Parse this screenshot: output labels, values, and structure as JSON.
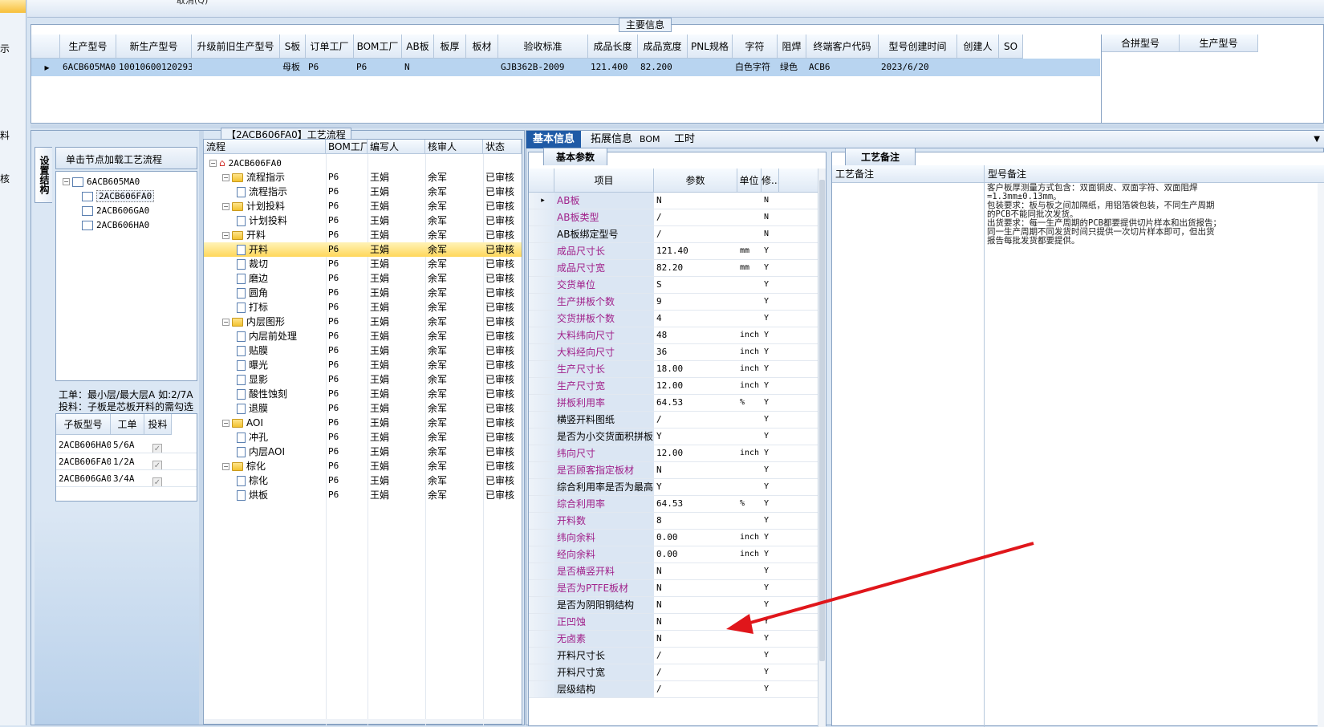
{
  "left_strip": {
    "items": [
      "示",
      "料",
      "核"
    ]
  },
  "top_bar": {
    "text": "取消(Q)"
  },
  "main_info": {
    "title": "主要信息",
    "columns": [
      "生产型号",
      "新生产型号",
      "升级前旧生产型号",
      "S板",
      "订单工厂",
      "BOM工厂",
      "AB板",
      "板厚",
      "板材",
      "验收标准",
      "成品长度",
      "成品宽度",
      "PNL规格",
      "字符",
      "阻焊",
      "终端客户代码",
      "型号创建时间",
      "创建人",
      "SO"
    ],
    "row": [
      "6ACB605MA0",
      "10010600120293",
      "",
      "母板",
      "P6",
      "P6",
      "N",
      "",
      "",
      "GJB362B-2009",
      "121.400",
      "82.200",
      "",
      "白色字符",
      "绿色",
      "ACB6",
      "2023/6/20",
      "",
      ""
    ],
    "right_columns": [
      "合拼型号",
      "生产型号"
    ]
  },
  "process_panel": {
    "title": "【2ACB606FA0】工艺流程",
    "side_tab": "设置结构",
    "hint": "单击节点加载工艺流程",
    "tree": [
      {
        "label": "6ACB605MA0",
        "level": 0,
        "expander": "⊟"
      },
      {
        "label": "2ACB606FA0",
        "level": 1,
        "selected": true
      },
      {
        "label": "2ACB606GA0",
        "level": 1
      },
      {
        "label": "2ACB606HA0",
        "level": 1
      }
    ],
    "note_line1": "工单：最小层/最大层A 如:2/7A",
    "note_line2": "投料：子板是芯板开料的需勾选",
    "sub_columns": [
      "子板型号",
      "工单",
      "投料"
    ],
    "sub_rows": [
      {
        "model": "2ACB606HA0",
        "order": "5/6A",
        "check": "✓"
      },
      {
        "model": "2ACB606FA0",
        "order": "1/2A",
        "check": "✓"
      },
      {
        "model": "2ACB606GA0",
        "order": "3/4A",
        "check": "✓"
      }
    ]
  },
  "flow": {
    "columns": [
      "流程",
      "BOM工厂",
      "编写人",
      "核审人",
      "状态"
    ],
    "root": "2ACB606FA0",
    "rows": [
      {
        "name": "流程指示",
        "type": "folder",
        "factory": "P6",
        "author": "王娟",
        "reviewer": "余军",
        "status": "已审核"
      },
      {
        "name": "流程指示",
        "type": "doc",
        "factory": "P6",
        "author": "王娟",
        "reviewer": "余军",
        "status": "已审核"
      },
      {
        "name": "计划投料",
        "type": "folder",
        "factory": "P6",
        "author": "王娟",
        "reviewer": "余军",
        "status": "已审核"
      },
      {
        "name": "计划投料",
        "type": "doc",
        "factory": "P6",
        "author": "王娟",
        "reviewer": "余军",
        "status": "已审核"
      },
      {
        "name": "开料",
        "type": "folder",
        "factory": "P6",
        "author": "王娟",
        "reviewer": "余军",
        "status": "已审核"
      },
      {
        "name": "开料",
        "type": "doc",
        "factory": "P6",
        "author": "王娟",
        "reviewer": "余军",
        "status": "已审核",
        "selected": true
      },
      {
        "name": "裁切",
        "type": "doc",
        "factory": "P6",
        "author": "王娟",
        "reviewer": "余军",
        "status": "已审核"
      },
      {
        "name": "磨边",
        "type": "doc",
        "factory": "P6",
        "author": "王娟",
        "reviewer": "余军",
        "status": "已审核"
      },
      {
        "name": "圆角",
        "type": "doc",
        "factory": "P6",
        "author": "王娟",
        "reviewer": "余军",
        "status": "已审核"
      },
      {
        "name": "打标",
        "type": "doc",
        "factory": "P6",
        "author": "王娟",
        "reviewer": "余军",
        "status": "已审核"
      },
      {
        "name": "内层图形",
        "type": "folder",
        "factory": "P6",
        "author": "王娟",
        "reviewer": "余军",
        "status": "已审核"
      },
      {
        "name": "内层前处理",
        "type": "doc",
        "factory": "P6",
        "author": "王娟",
        "reviewer": "余军",
        "status": "已审核"
      },
      {
        "name": "贴膜",
        "type": "doc",
        "factory": "P6",
        "author": "王娟",
        "reviewer": "余军",
        "status": "已审核"
      },
      {
        "name": "曝光",
        "type": "doc",
        "factory": "P6",
        "author": "王娟",
        "reviewer": "余军",
        "status": "已审核"
      },
      {
        "name": "显影",
        "type": "doc",
        "factory": "P6",
        "author": "王娟",
        "reviewer": "余军",
        "status": "已审核"
      },
      {
        "name": "酸性蚀刻",
        "type": "doc",
        "factory": "P6",
        "author": "王娟",
        "reviewer": "余军",
        "status": "已审核"
      },
      {
        "name": "退膜",
        "type": "doc",
        "factory": "P6",
        "author": "王娟",
        "reviewer": "余军",
        "status": "已审核"
      },
      {
        "name": "AOI",
        "type": "folder",
        "factory": "P6",
        "author": "王娟",
        "reviewer": "余军",
        "status": "已审核"
      },
      {
        "name": "冲孔",
        "type": "doc",
        "factory": "P6",
        "author": "王娟",
        "reviewer": "余军",
        "status": "已审核"
      },
      {
        "name": "内层AOI",
        "type": "doc",
        "factory": "P6",
        "author": "王娟",
        "reviewer": "余军",
        "status": "已审核"
      },
      {
        "name": "棕化",
        "type": "folder",
        "factory": "P6",
        "author": "王娟",
        "reviewer": "余军",
        "status": "已审核"
      },
      {
        "name": "棕化",
        "type": "doc",
        "factory": "P6",
        "author": "王娟",
        "reviewer": "余军",
        "status": "已审核"
      },
      {
        "name": "烘板",
        "type": "doc",
        "factory": "P6",
        "author": "王娟",
        "reviewer": "余军",
        "status": "已审核"
      }
    ]
  },
  "right_tabs": [
    "基本信息",
    "拓展信息",
    "BOM",
    "工时"
  ],
  "basic_params": {
    "tab": "基本参数",
    "columns": [
      "项目",
      "参数",
      "单位",
      "修..."
    ],
    "rows": [
      {
        "item": "AB板",
        "value": "N",
        "unit": "",
        "mod": "N",
        "purple": true
      },
      {
        "item": "AB板类型",
        "value": "/",
        "unit": "",
        "mod": "N",
        "purple": true
      },
      {
        "item": "AB板绑定型号",
        "value": "/",
        "unit": "",
        "mod": "N",
        "purple": false
      },
      {
        "item": "成品尺寸长",
        "value": "121.40",
        "unit": "mm",
        "mod": "Y",
        "purple": true
      },
      {
        "item": "成品尺寸宽",
        "value": "82.20",
        "unit": "mm",
        "mod": "Y",
        "purple": true
      },
      {
        "item": "交货单位",
        "value": "S",
        "unit": "",
        "mod": "Y",
        "purple": true
      },
      {
        "item": "生产拼板个数",
        "value": "9",
        "unit": "",
        "mod": "Y",
        "purple": true
      },
      {
        "item": "交货拼板个数",
        "value": "4",
        "unit": "",
        "mod": "Y",
        "purple": true
      },
      {
        "item": "大料纬向尺寸",
        "value": "48",
        "unit": "inch",
        "mod": "Y",
        "purple": true
      },
      {
        "item": "大料经向尺寸",
        "value": "36",
        "unit": "inch",
        "mod": "Y",
        "purple": true
      },
      {
        "item": "生产尺寸长",
        "value": "18.00",
        "unit": "inch",
        "mod": "Y",
        "purple": true
      },
      {
        "item": "生产尺寸宽",
        "value": "12.00",
        "unit": "inch",
        "mod": "Y",
        "purple": true
      },
      {
        "item": "拼板利用率",
        "value": "64.53",
        "unit": "%",
        "mod": "Y",
        "purple": true
      },
      {
        "item": "横竖开料图纸",
        "value": "/",
        "unit": "",
        "mod": "Y",
        "purple": false
      },
      {
        "item": "是否为小交货面积拼板",
        "value": "Y",
        "unit": "",
        "mod": "Y",
        "purple": false
      },
      {
        "item": "纬向尺寸",
        "value": "12.00",
        "unit": "inch",
        "mod": "Y",
        "purple": true
      },
      {
        "item": "是否顾客指定板材",
        "value": "N",
        "unit": "",
        "mod": "Y",
        "purple": true
      },
      {
        "item": "综合利用率是否为最高",
        "value": "Y",
        "unit": "",
        "mod": "Y",
        "purple": false
      },
      {
        "item": "综合利用率",
        "value": "64.53",
        "unit": "%",
        "mod": "Y",
        "purple": true
      },
      {
        "item": "开料数",
        "value": "8",
        "unit": "",
        "mod": "Y",
        "purple": true
      },
      {
        "item": "纬向余料",
        "value": "0.00",
        "unit": "inch",
        "mod": "Y",
        "purple": true
      },
      {
        "item": "经向余料",
        "value": "0.00",
        "unit": "inch",
        "mod": "Y",
        "purple": true
      },
      {
        "item": "是否横竖开料",
        "value": "N",
        "unit": "",
        "mod": "Y",
        "purple": true
      },
      {
        "item": "是否为PTFE板材",
        "value": "N",
        "unit": "",
        "mod": "Y",
        "purple": true
      },
      {
        "item": "是否为阴阳铜结构",
        "value": "N",
        "unit": "",
        "mod": "Y",
        "purple": false
      },
      {
        "item": "正凹蚀",
        "value": "N",
        "unit": "",
        "mod": "Y",
        "purple": true
      },
      {
        "item": "无卤素",
        "value": "N",
        "unit": "",
        "mod": "Y",
        "purple": true
      },
      {
        "item": "开料尺寸长",
        "value": "/",
        "unit": "",
        "mod": "Y",
        "purple": false
      },
      {
        "item": "开料尺寸宽",
        "value": "/",
        "unit": "",
        "mod": "Y",
        "purple": false
      },
      {
        "item": "层级结构",
        "value": "/",
        "unit": "",
        "mod": "Y",
        "purple": false
      }
    ]
  },
  "craft_notes": {
    "tab": "工艺备注",
    "col1": "工艺备注",
    "col2": "型号备注",
    "note_lines": [
      "客户板厚测量方式包含：双面铜皮、双面字符、双面阻焊",
      "=1.3mm±0.13mm。",
      "包装要求：板与板之间加隔纸，用铝箔袋包装，不同生产周期",
      "的PCB不能同批次发货。",
      "出货要求：每一生产周期的PCB都要提供切片样本和出货报告；",
      "同一生产周期不同发货时间只提供一次切片样本即可，但出货",
      "报告每批发货都要提供。"
    ]
  },
  "colors": {
    "accent": "#a0208a",
    "selection": "#b8d4f0",
    "highlight": "#ffd75a",
    "arrow": "#e0161b"
  }
}
